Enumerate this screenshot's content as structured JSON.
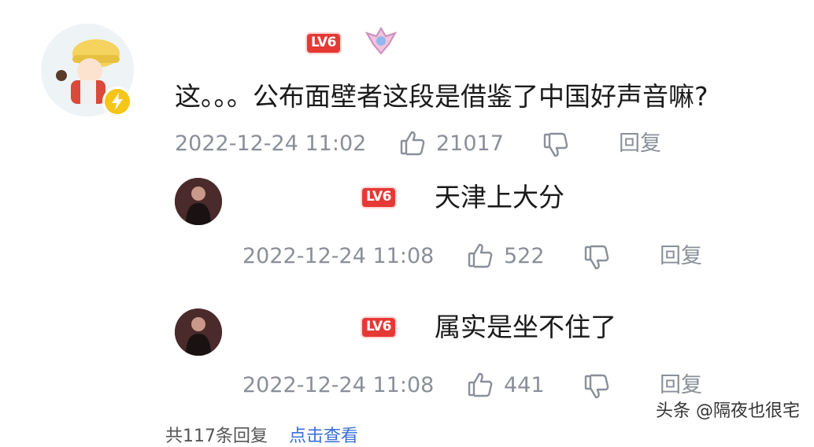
{
  "main_comment": {
    "level": "LV6",
    "text": "这。。。公布面壁者这段是借鉴了中国好声音嘛?",
    "time": "2022-12-24 11:02",
    "likes": "21017",
    "reply_label": "回复"
  },
  "replies": [
    {
      "level": "LV6",
      "text": "天津上大分",
      "time": "2022-12-24 11:08",
      "likes": "522",
      "reply_label": "回复"
    },
    {
      "level": "LV6",
      "text": "属实是坐不住了",
      "time": "2022-12-24 11:08",
      "likes": "441",
      "reply_label": "回复"
    }
  ],
  "footer": {
    "count_text": "共117条回复",
    "expand_text": "点击查看"
  },
  "watermark": "头条 @隔夜也很宅",
  "colors": {
    "level_badge": "#e53935",
    "meta_text": "#8a8f99",
    "verified_badge": "#f5c518"
  }
}
